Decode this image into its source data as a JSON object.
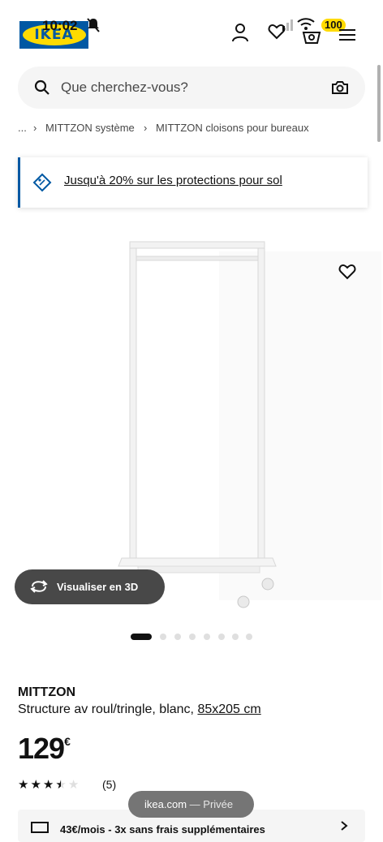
{
  "status_bar": {
    "time": "10:02",
    "battery": "100"
  },
  "header": {
    "logo_text": "IKEA"
  },
  "search": {
    "placeholder": "Que cherchez-vous?"
  },
  "breadcrumb": [
    "...",
    "MITTZON système",
    "MITTZON cloisons pour bureaux"
  ],
  "promo": {
    "text": "Jusqu'à 20% sur les protections pour sol"
  },
  "product": {
    "view_3d_label": "Visualiser en 3D",
    "image_count": 8,
    "active_image": 1,
    "brand": "MITTZON",
    "description": "Structure av roul/tringle, blanc,",
    "size": "85x205 cm",
    "price": "129",
    "currency": "€",
    "rating": 3.5,
    "rating_max": 5,
    "review_count": "(5)",
    "finance_text": "43€/mois - 3x sans frais supplémentaires"
  },
  "toast": {
    "domain": "ikea.com",
    "mode": "— Privée"
  },
  "colors": {
    "ikea_blue": "#0058a3",
    "ikea_yellow": "#ffdb00",
    "text": "#111111",
    "muted": "#484848"
  }
}
